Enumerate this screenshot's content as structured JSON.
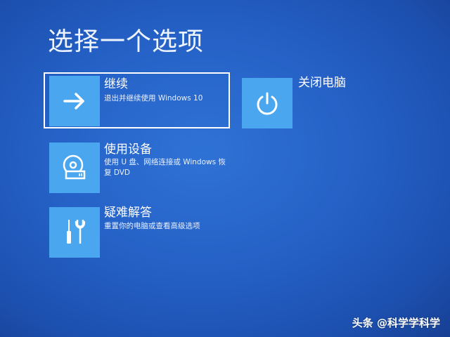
{
  "page": {
    "title": "选择一个选项"
  },
  "options": [
    {
      "title": "继续",
      "description": "退出并继续使用 Windows 10",
      "icon": "arrow-right-icon"
    },
    {
      "title": "使用设备",
      "description": "使用 U 盘、网络连接或 Windows 恢复 DVD",
      "icon": "disc-drive-icon"
    },
    {
      "title": "疑难解答",
      "description": "重置你的电脑或查看高级选项",
      "icon": "tools-icon"
    },
    {
      "title": "关闭电脑",
      "description": "",
      "icon": "power-icon"
    }
  ],
  "watermark": {
    "text": "头条 @科学学科学"
  },
  "colors": {
    "background": "#2561c6",
    "tile": "#4aa6ee",
    "text": "#ffffff"
  }
}
